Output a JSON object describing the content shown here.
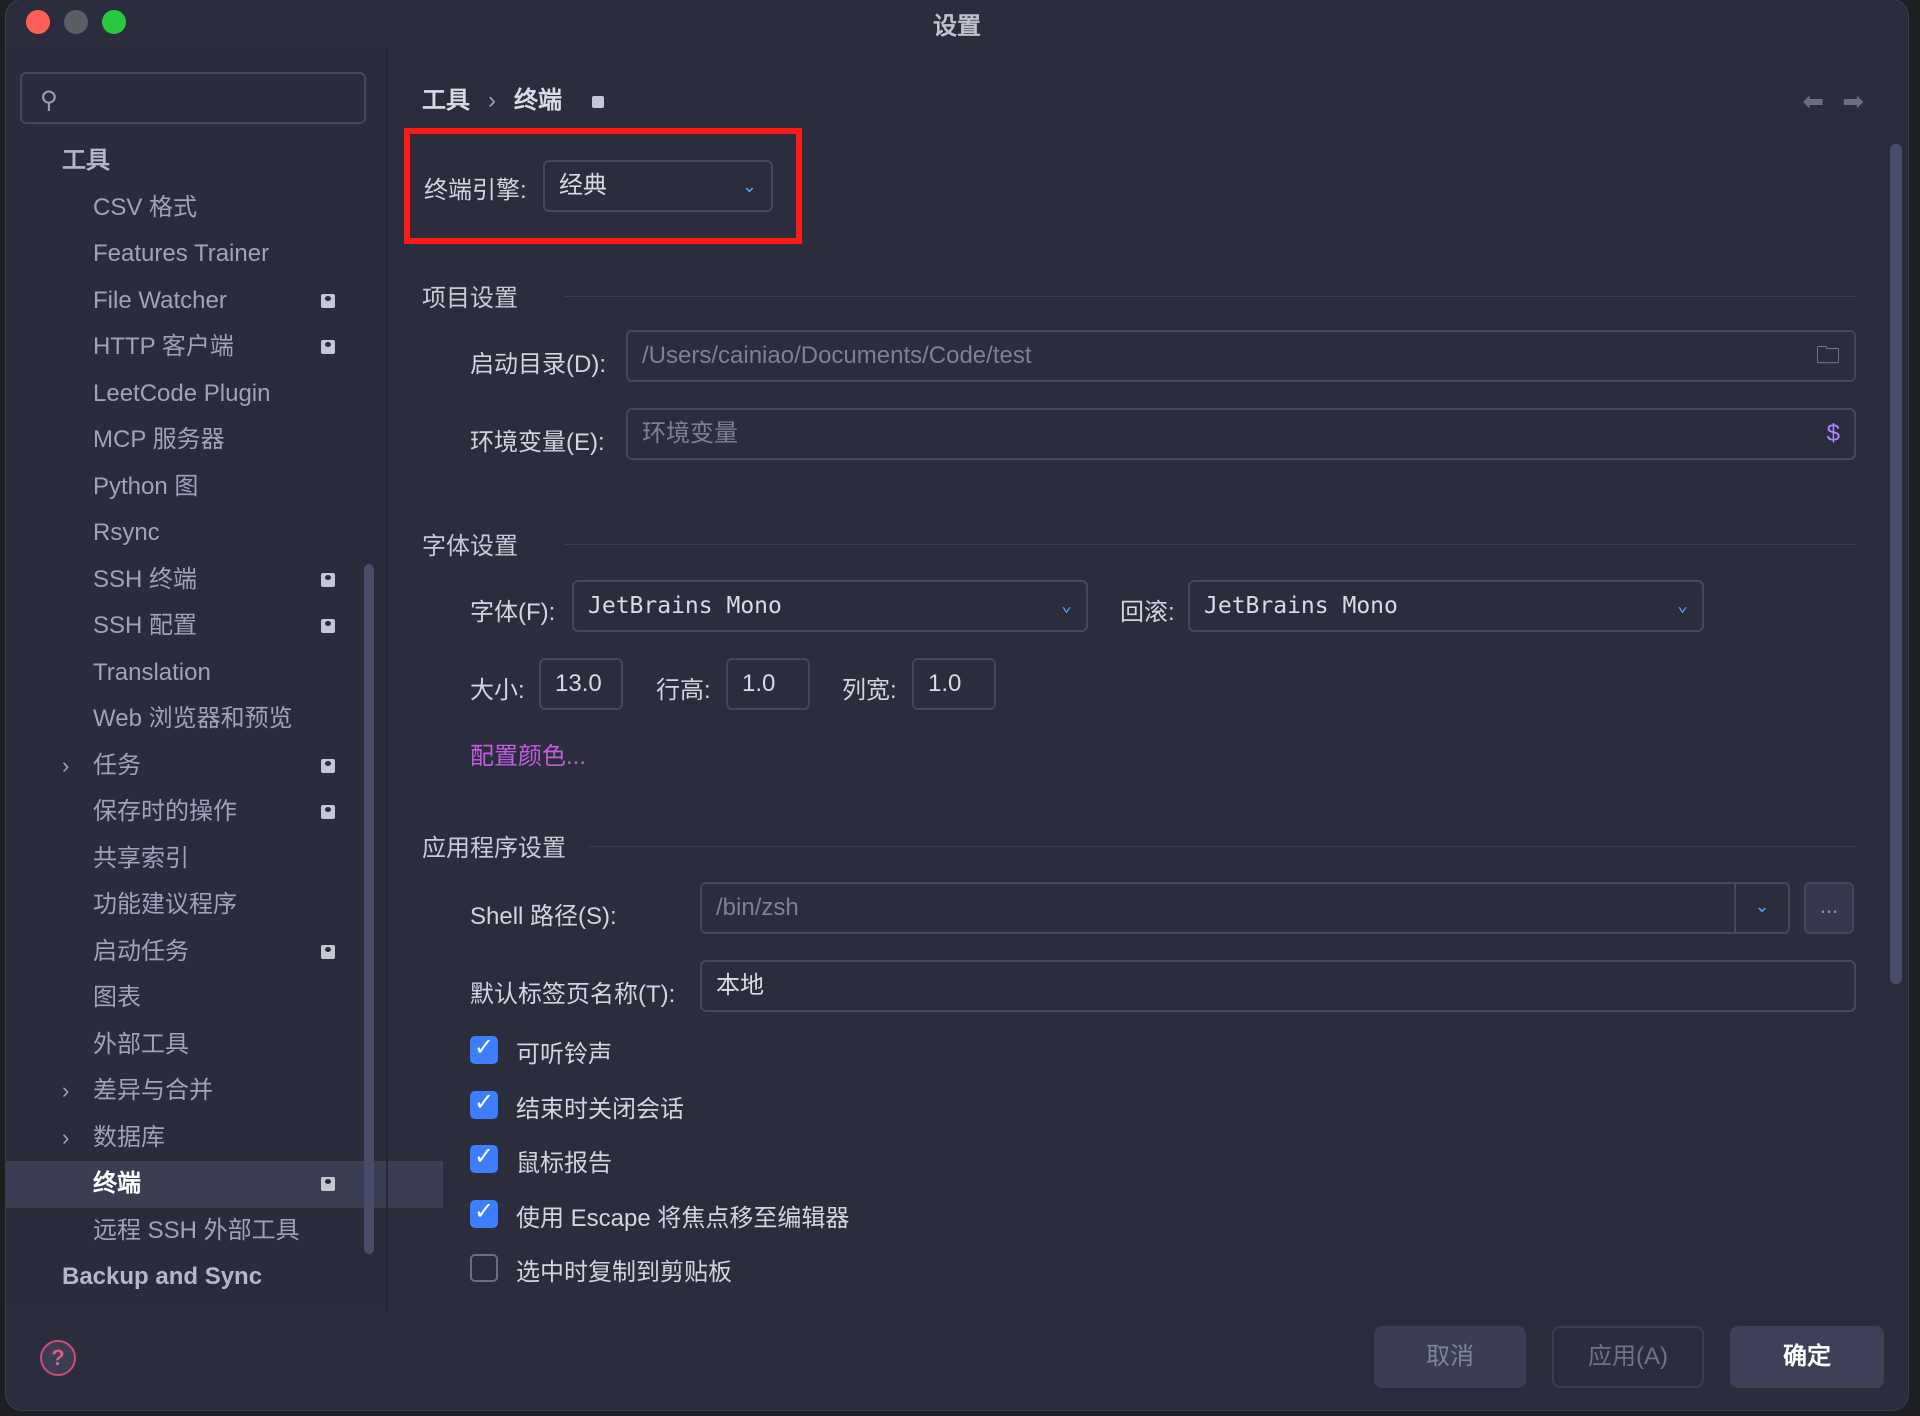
{
  "window": {
    "title": "设置"
  },
  "sidebar": {
    "search_placeholder": "",
    "items": [
      {
        "label": "工具",
        "level": 0
      },
      {
        "label": "CSV 格式",
        "level": 1
      },
      {
        "label": "Features Trainer",
        "level": 1
      },
      {
        "label": "File Watcher",
        "level": 1,
        "badge": true
      },
      {
        "label": "HTTP 客户端",
        "level": 1,
        "badge": true
      },
      {
        "label": "LeetCode Plugin",
        "level": 1
      },
      {
        "label": "MCP 服务器",
        "level": 1
      },
      {
        "label": "Python 图",
        "level": 1
      },
      {
        "label": "Rsync",
        "level": 1
      },
      {
        "label": "SSH 终端",
        "level": 1,
        "badge": true
      },
      {
        "label": "SSH 配置",
        "level": 1,
        "badge": true
      },
      {
        "label": "Translation",
        "level": 1
      },
      {
        "label": "Web 浏览器和预览",
        "level": 1
      },
      {
        "label": "任务",
        "level": 1,
        "badge": true,
        "expandable": true
      },
      {
        "label": "保存时的操作",
        "level": 1,
        "badge": true
      },
      {
        "label": "共享索引",
        "level": 1
      },
      {
        "label": "功能建议程序",
        "level": 1
      },
      {
        "label": "启动任务",
        "level": 1,
        "badge": true
      },
      {
        "label": "图表",
        "level": 1
      },
      {
        "label": "外部工具",
        "level": 1
      },
      {
        "label": "差异与合并",
        "level": 1,
        "expandable": true
      },
      {
        "label": "数据库",
        "level": 1,
        "expandable": true
      },
      {
        "label": "终端",
        "level": 1,
        "badge": true,
        "selected": true
      },
      {
        "label": "远程 SSH 外部工具",
        "level": 1
      },
      {
        "label": "Backup and Sync",
        "level": 0
      }
    ]
  },
  "breadcrumb": {
    "parent": "工具",
    "separator": "›",
    "current": "终端"
  },
  "engine": {
    "label": "终端引擎:",
    "value": "经典"
  },
  "project_settings": {
    "title": "项目设置",
    "start_dir_label": "启动目录(D):",
    "start_dir_value": "/Users/cainiao/Documents/Code/test",
    "env_label": "环境变量(E):",
    "env_placeholder": "环境变量"
  },
  "font_settings": {
    "title": "字体设置",
    "font_label": "字体(F):",
    "font_value": "JetBrains Mono",
    "fallback_label": "回滚:",
    "fallback_value": "JetBrains Mono",
    "size_label": "大小:",
    "size_value": "13.0",
    "line_height_label": "行高:",
    "line_height_value": "1.0",
    "col_width_label": "列宽:",
    "col_width_value": "1.0",
    "color_link": "配置颜色..."
  },
  "app_settings": {
    "title": "应用程序设置",
    "shell_label": "Shell 路径(S):",
    "shell_value": "/bin/zsh",
    "browse_label": "...",
    "tab_name_label": "默认标签页名称(T):",
    "tab_name_value": "本地",
    "checkboxes": [
      {
        "label": "可听铃声",
        "checked": true
      },
      {
        "label": "结束时关闭会话",
        "checked": true
      },
      {
        "label": "鼠标报告",
        "checked": true
      },
      {
        "label": "使用 Escape 将焦点移至编辑器",
        "checked": true
      },
      {
        "label": "选中时复制到剪贴板",
        "checked": false
      }
    ]
  },
  "footer": {
    "cancel": "取消",
    "apply": "应用(A)",
    "ok": "确定"
  },
  "colors": {
    "accent": "#3d7eff",
    "link": "#c45ce0",
    "highlight": "#ff1a1a",
    "background": "#2b2d3d"
  }
}
